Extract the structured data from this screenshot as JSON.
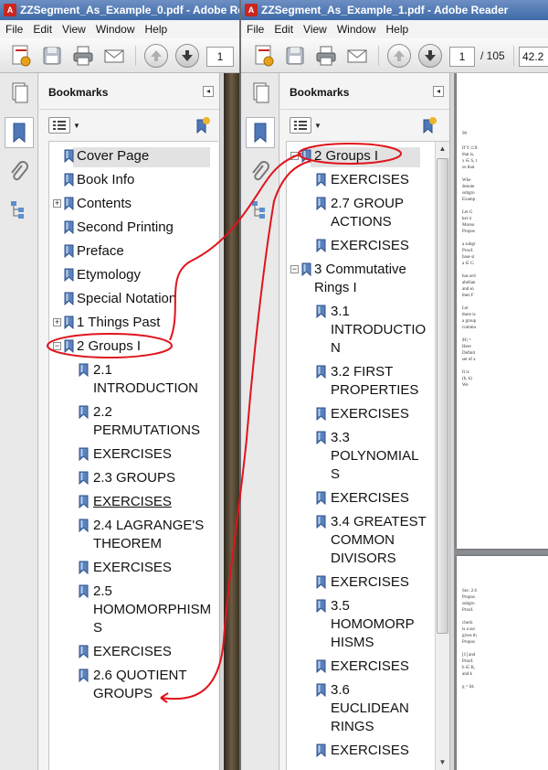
{
  "window1": {
    "title": "ZZSegment_As_Example_0.pdf - Adobe Re",
    "menu": [
      "File",
      "Edit",
      "View",
      "Window",
      "Help"
    ],
    "page_number": "1",
    "panel_title": "Bookmarks",
    "bookmarks": [
      {
        "label": "Cover Page"
      },
      {
        "label": "Book Info"
      },
      {
        "label": "Contents",
        "expand": "+"
      },
      {
        "label": "Second Printing"
      },
      {
        "label": "Preface"
      },
      {
        "label": "Etymology"
      },
      {
        "label": "Special Notation"
      },
      {
        "label": "1 Things Past",
        "expand": "+"
      },
      {
        "label": "2 Groups I",
        "expand": "−"
      },
      {
        "label": [
          "2.1",
          "INTRODUCTION"
        ]
      },
      {
        "label": [
          "2.2",
          "PERMUTATIONS"
        ]
      },
      {
        "label": "EXERCISES"
      },
      {
        "label": "2.3 GROUPS"
      },
      {
        "label": "EXERCISES"
      },
      {
        "label": [
          "2.4 LAGRANGE'S",
          "THEOREM"
        ]
      },
      {
        "label": "EXERCISES"
      },
      {
        "label": [
          "2.5",
          "HOMOMORPHISM",
          "S"
        ]
      },
      {
        "label": "EXERCISES"
      },
      {
        "label": [
          "2.6 QUOTIENT",
          "GROUPS"
        ]
      }
    ]
  },
  "window2": {
    "title": "ZZSegment_As_Example_1.pdf - Adobe Reader",
    "menu": [
      "File",
      "Edit",
      "View",
      "Window",
      "Help"
    ],
    "page_number": "1",
    "page_total": "/ 105",
    "zoom": "42.2",
    "panel_title": "Bookmarks",
    "bookmarks": [
      {
        "label": "2 Groups I",
        "expand": "−"
      },
      {
        "label": "EXERCISES"
      },
      {
        "label": [
          "2.7 GROUP",
          "ACTIONS"
        ]
      },
      {
        "label": "EXERCISES"
      },
      {
        "label": [
          "3 Commutative",
          "Rings I"
        ],
        "expand": "−"
      },
      {
        "label": [
          "3.1",
          "INTRODUCTIO",
          "N"
        ]
      },
      {
        "label": [
          "3.2 FIRST",
          "PROPERTIES"
        ]
      },
      {
        "label": "EXERCISES"
      },
      {
        "label": [
          "3.3",
          "POLYNOMIAL",
          "S"
        ]
      },
      {
        "label": "EXERCISES"
      },
      {
        "label": [
          "3.4 GREATEST",
          "COMMON",
          "DIVISORS"
        ]
      },
      {
        "label": "EXERCISES"
      },
      {
        "label": [
          "3.5",
          "HOMOMORP",
          "HISMS"
        ]
      },
      {
        "label": "EXERCISES"
      },
      {
        "label": [
          "3.6",
          "EUCLIDEAN",
          "RINGS"
        ]
      },
      {
        "label": "EXERCISES"
      }
    ],
    "doc_text": {
      "page_num": "90",
      "lines1": [
        "If Y ⊂X",
        "that is,",
        "x ∈ S, t",
        "so that",
        "Whe",
        "denote",
        "subgro",
        "Examp",
        "Let G",
        "ker π",
        "Moreo",
        "Propos",
        "a subgr",
        "Proof.",
        "base st",
        "a ∈ G",
        "has ord",
        "abelian",
        "and so",
        "then F",
        "Let",
        "there is",
        "a group",
        "commu",
        "|H| =",
        "Here",
        "Definit",
        "set of a",
        "It is",
        "(h, k)",
        "We"
      ],
      "lines2": [
        "Sec. 2.6",
        "Propos",
        "subgro",
        "Proof.",
        "check",
        "is a sur",
        "gives th",
        "Propos",
        "[1] and",
        "Proof.",
        "h ∈ K,",
        "and k",
        "g = hk"
      ]
    }
  }
}
